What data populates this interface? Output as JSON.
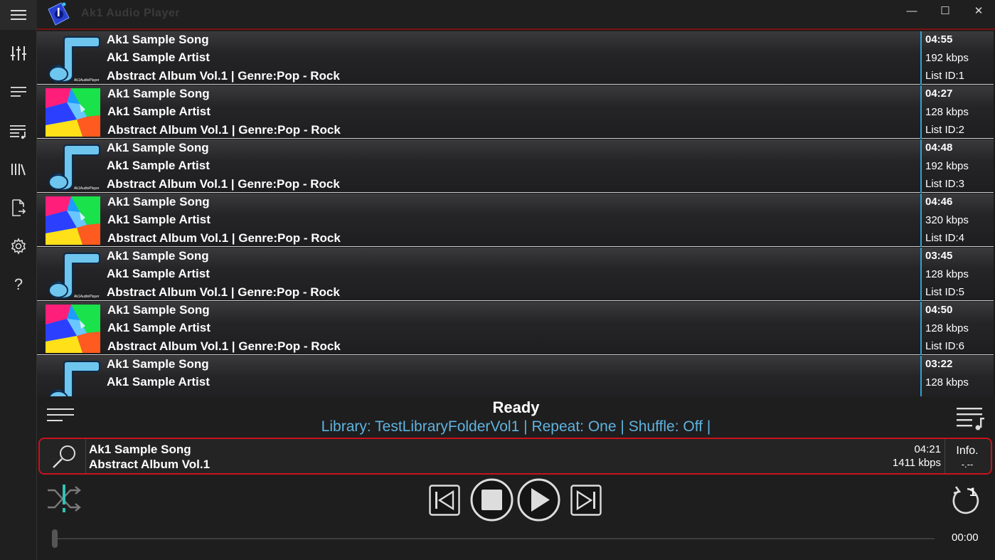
{
  "app": {
    "title": "Ak1 Audio Player",
    "accent": "#2ea3d8",
    "border_red": "#c8121b"
  },
  "window_controls": {
    "minimize": "—",
    "maximize": "☐",
    "close": "✕"
  },
  "sidebar": {
    "items": [
      {
        "name": "equalizer",
        "icon": "sliders-icon"
      },
      {
        "name": "now-playing",
        "icon": "list-lines-icon"
      },
      {
        "name": "playlists",
        "icon": "playlist-icon"
      },
      {
        "name": "library",
        "icon": "library-icon"
      },
      {
        "name": "export",
        "icon": "file-export-icon"
      },
      {
        "name": "settings",
        "icon": "gear-icon"
      },
      {
        "name": "help",
        "icon": "help-icon"
      }
    ]
  },
  "tracks": [
    {
      "title": "Ak1 Sample Song",
      "artist": "Ak1 Sample Artist",
      "album_line": "Abstract Album Vol.1 | Genre:Pop - Rock",
      "duration": "04:55",
      "bitrate": "192 kbps",
      "list_id": "List ID:1",
      "art": "note"
    },
    {
      "title": "Ak1 Sample Song",
      "artist": "Ak1 Sample Artist",
      "album_line": "Abstract Album Vol.1 | Genre:Pop - Rock",
      "duration": "04:27",
      "bitrate": "128 kbps",
      "list_id": "List ID:2",
      "art": "abstract"
    },
    {
      "title": "Ak1 Sample Song",
      "artist": "Ak1 Sample Artist",
      "album_line": "Abstract Album Vol.1 | Genre:Pop - Rock",
      "duration": "04:48",
      "bitrate": "192 kbps",
      "list_id": "List ID:3",
      "art": "note"
    },
    {
      "title": "Ak1 Sample Song",
      "artist": "Ak1 Sample Artist",
      "album_line": "Abstract Album Vol.1 | Genre:Pop - Rock",
      "duration": "04:46",
      "bitrate": "320 kbps",
      "list_id": "List ID:4",
      "art": "abstract"
    },
    {
      "title": "Ak1 Sample Song",
      "artist": "Ak1 Sample Artist",
      "album_line": "Abstract Album Vol.1 | Genre:Pop - Rock",
      "duration": "03:45",
      "bitrate": "128 kbps",
      "list_id": "List ID:5",
      "art": "note"
    },
    {
      "title": "Ak1 Sample Song",
      "artist": "Ak1 Sample Artist",
      "album_line": "Abstract Album Vol.1 | Genre:Pop - Rock",
      "duration": "04:50",
      "bitrate": "128 kbps",
      "list_id": "List ID:6",
      "art": "abstract"
    },
    {
      "title": "Ak1 Sample Song",
      "artist": "Ak1 Sample Artist",
      "album_line": "",
      "duration": "03:22",
      "bitrate": "128 kbps",
      "list_id": "",
      "art": "note"
    }
  ],
  "status": {
    "state": "Ready",
    "library_label": "Library:",
    "library_value": "TestLibraryFolderVol1",
    "sep1": "|",
    "repeat_label": "Repeat:",
    "repeat_value": "One",
    "sep2": "|",
    "shuffle_label": "Shuffle:",
    "shuffle_value": "Off",
    "sep3": "|"
  },
  "now_playing": {
    "title": "Ak1 Sample Song",
    "album": "Abstract Album Vol.1",
    "duration": "04:21",
    "bitrate": "1411 kbps",
    "info_label": "Info.",
    "info_value": "-.--"
  },
  "controls": {
    "repeat_count": "1",
    "position_time": "00:00",
    "progress_fraction": 0
  }
}
